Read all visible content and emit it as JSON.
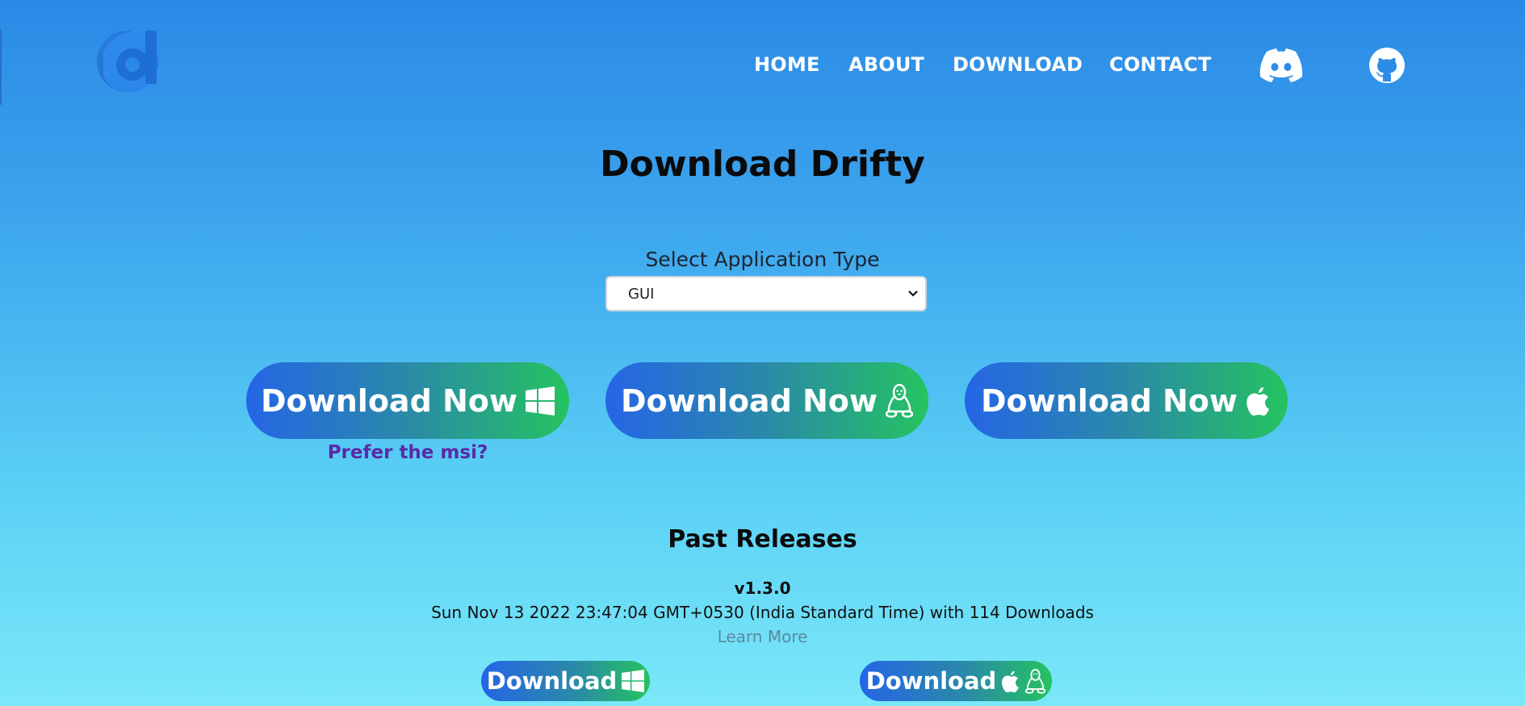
{
  "nav": {
    "items": [
      {
        "label": "HOME"
      },
      {
        "label": "ABOUT"
      },
      {
        "label": "DOWNLOAD"
      },
      {
        "label": "CONTACT"
      }
    ],
    "icons": [
      "discord-icon",
      "github-icon"
    ]
  },
  "page": {
    "title": "Download Drifty"
  },
  "selector": {
    "label": "Select Application Type",
    "value": "GUI"
  },
  "downloads": [
    {
      "label": "Download Now",
      "icon": "windows-icon"
    },
    {
      "label": "Download Now",
      "icon": "linux-icon"
    },
    {
      "label": "Download Now",
      "icon": "apple-icon"
    }
  ],
  "msi_link": "Prefer the msi?",
  "past_releases": {
    "title": "Past Releases",
    "releases": [
      {
        "version": "v1.3.0",
        "info": "Sun Nov 13 2022 23:47:04 GMT+0530 (India Standard Time) with 114 Downloads",
        "learn_more": "Learn More",
        "buttons": [
          {
            "label": "Download",
            "icons": [
              "windows-icon"
            ]
          },
          {
            "label": "Download",
            "icons": [
              "apple-icon",
              "linux-icon"
            ]
          }
        ]
      }
    ]
  },
  "colors": {
    "gradient_start": "#2565e6",
    "gradient_end": "#25c35f",
    "msi_link": "#5a2aa8",
    "learn_more": "#5b8aa0"
  }
}
